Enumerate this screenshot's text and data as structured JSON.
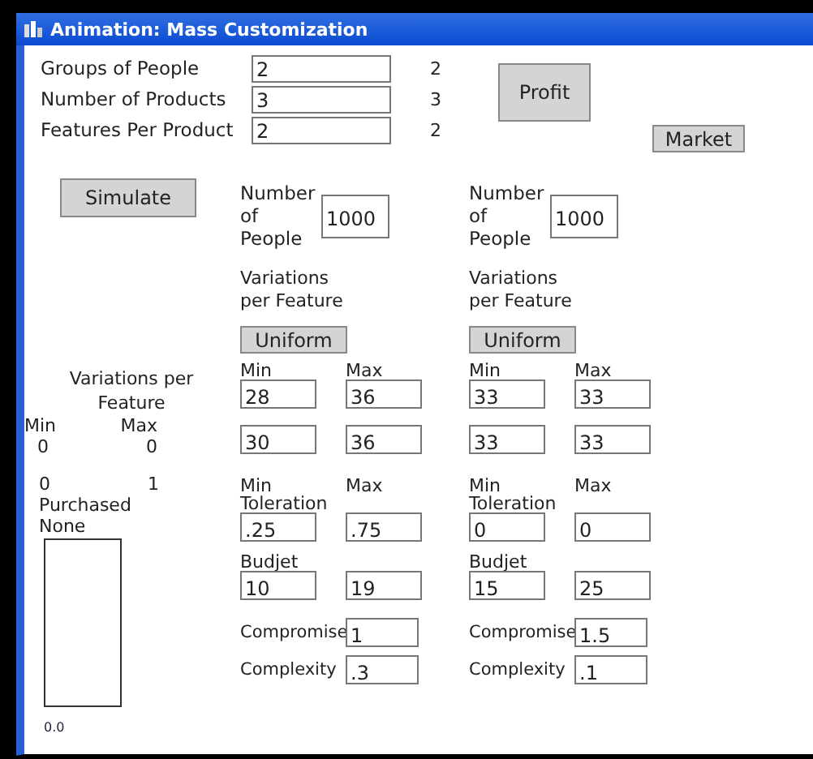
{
  "window": {
    "title": "Animation: Mass Customization"
  },
  "parameters": [
    {
      "label": "Groups of People",
      "value": "2",
      "reading": "2"
    },
    {
      "label": "Number of Products",
      "value": "3",
      "reading": "3"
    },
    {
      "label": "Features Per Product",
      "value": "2",
      "reading": "2"
    }
  ],
  "buttons": {
    "profit": "Profit",
    "market": "Market",
    "simulate": "Simulate"
  },
  "summary": {
    "heading": "Variations per Feature",
    "min_label": "Min",
    "max_label": "Max",
    "min_value": "0",
    "max_value": "0",
    "range_start": "0",
    "range_end": "1",
    "purchased_label": "Purchased",
    "purchased_value": "None",
    "axis_label": "0.0"
  },
  "groups": [
    {
      "people_label": "Number of People",
      "people": "1000",
      "variations_label": "Variations per Feature",
      "distribution_button": "Uniform",
      "min_label": "Min",
      "max_label": "Max",
      "variation_rows": [
        [
          "28",
          "36"
        ],
        [
          "30",
          "36"
        ]
      ],
      "min_label_2": "Min",
      "max_label_2": "Max",
      "toleration_label": "Toleration",
      "toleration": [
        ".25",
        ".75"
      ],
      "budget_label": "Budjet",
      "budget": [
        "10",
        "19"
      ],
      "compromise_label": "Compromise",
      "compromise": "1",
      "complexity_label": "Complexity",
      "complexity": ".3"
    },
    {
      "people_label": "Number of People",
      "people": "1000",
      "variations_label": "Variations per Feature",
      "distribution_button": "Uniform",
      "min_label": "Min",
      "max_label": "Max",
      "variation_rows": [
        [
          "33",
          "33"
        ],
        [
          "33",
          "33"
        ]
      ],
      "min_label_2": "Min",
      "max_label_2": "Max",
      "toleration_label": "Toleration",
      "toleration": [
        "0",
        "0"
      ],
      "budget_label": "Budjet",
      "budget": [
        "15",
        "25"
      ],
      "compromise_label": "Compromise",
      "compromise": "1.5",
      "complexity_label": "Complexity",
      "complexity": ".1"
    }
  ]
}
